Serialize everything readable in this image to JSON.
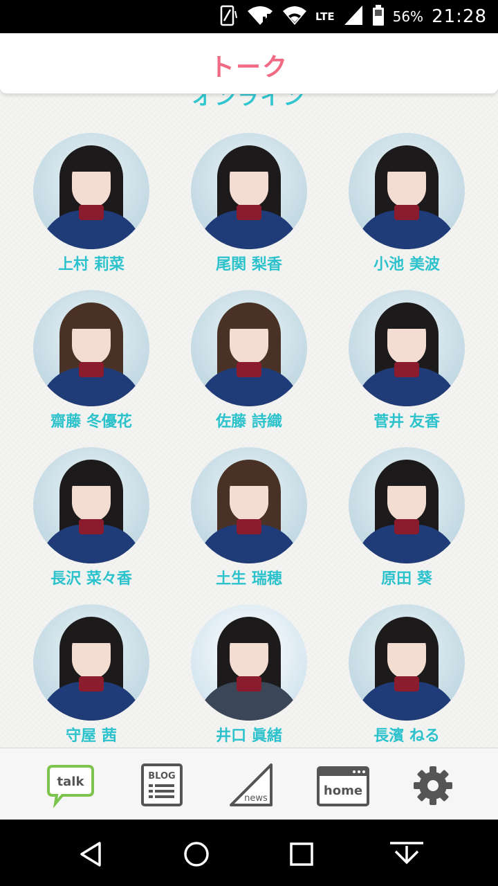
{
  "status_bar": {
    "time": "21:28",
    "battery_percent": "56%",
    "network": "LTE",
    "icons": [
      "vibrate-icon",
      "wifi-calling-icon",
      "wifi-icon",
      "lte-signal-icon",
      "battery-icon"
    ]
  },
  "header": {
    "title": "トーク",
    "subtitle": "オンライン"
  },
  "members": [
    {
      "name": "上村 莉菜"
    },
    {
      "name": "尾関 梨香"
    },
    {
      "name": "小池 美波"
    },
    {
      "name": "齋藤 冬優花"
    },
    {
      "name": "佐藤 詩織"
    },
    {
      "name": "菅井 友香"
    },
    {
      "name": "長沢 菜々香"
    },
    {
      "name": "土生 瑞穂"
    },
    {
      "name": "原田 葵"
    },
    {
      "name": "守屋 茜"
    },
    {
      "name": "井口 眞緒"
    },
    {
      "name": "長濱 ねる"
    }
  ],
  "bottom_nav": {
    "talk_label": "talk",
    "blog_label": "BLOG",
    "news_label": "news",
    "home_label": "home",
    "accent_color": "#7cc44e",
    "icon_color": "#555555"
  },
  "system_nav": {
    "icons": [
      "back-icon",
      "home-circle-icon",
      "recents-icon",
      "notification-pull-icon"
    ]
  },
  "colors": {
    "title": "#f06a84",
    "subtitle": "#2fc6cf",
    "member_name": "#2cc2cc"
  }
}
